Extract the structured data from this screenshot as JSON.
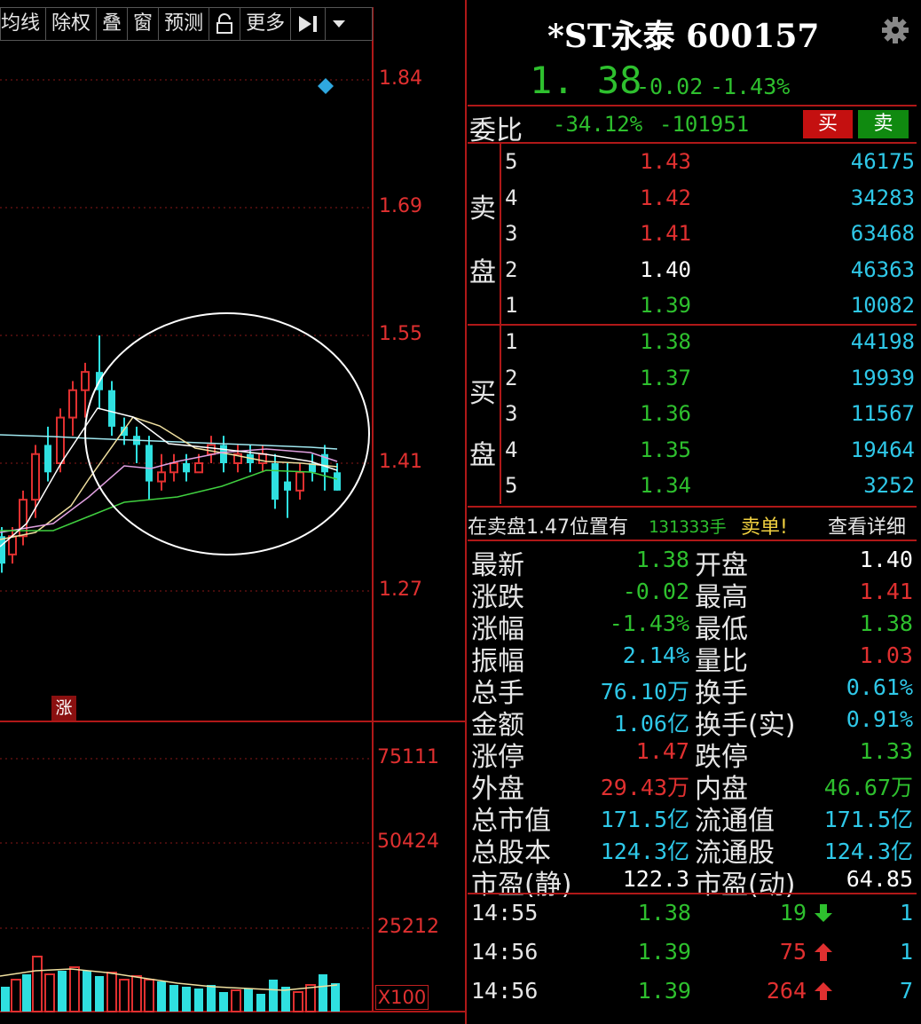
{
  "toolbar": {
    "items": [
      "均线",
      "除权",
      "叠",
      "窗",
      "预测",
      "更多"
    ]
  },
  "price_axis": [
    "1.84",
    "1.69",
    "1.55",
    "1.41",
    "1.27"
  ],
  "volume_axis": [
    "75111",
    "50424",
    "25212"
  ],
  "volume_unit": "X100",
  "rise_badge": "涨",
  "colors": {
    "up": "#e03030",
    "down": "#2fe0e0",
    "green": "#2ec02e",
    "cyan": "#2fc8e8",
    "grid_red": "#b01818"
  },
  "quote": {
    "title": "*ST永泰 600157",
    "last": "1. 38",
    "change": "-0.02",
    "change_pct": "-1.43%",
    "weibi_label": "委比",
    "weibi": "-34.12%",
    "weicha": "-101951",
    "buy_label": "买",
    "sell_label": "卖"
  },
  "order_book": {
    "sell_label_1": "卖",
    "sell_label_2": "盘",
    "buy_label_1": "买",
    "buy_label_2": "盘",
    "asks": [
      {
        "level": "5",
        "price": "1.43",
        "volume": "46175",
        "color": "#e03030"
      },
      {
        "level": "4",
        "price": "1.42",
        "volume": "34283",
        "color": "#e03030"
      },
      {
        "level": "3",
        "price": "1.41",
        "volume": "63468",
        "color": "#e03030"
      },
      {
        "level": "2",
        "price": "1.40",
        "volume": "46363",
        "color": "#ffffff"
      },
      {
        "level": "1",
        "price": "1.39",
        "volume": "10082",
        "color": "#2ec02e"
      }
    ],
    "bids": [
      {
        "level": "1",
        "price": "1.38",
        "volume": "44198",
        "color": "#2ec02e"
      },
      {
        "level": "2",
        "price": "1.37",
        "volume": "19939",
        "color": "#2ec02e"
      },
      {
        "level": "3",
        "price": "1.36",
        "volume": "11567",
        "color": "#2ec02e"
      },
      {
        "level": "4",
        "price": "1.35",
        "volume": "19464",
        "color": "#2ec02e"
      },
      {
        "level": "5",
        "price": "1.34",
        "volume": "3252",
        "color": "#2ec02e"
      }
    ]
  },
  "notice": {
    "prefix": "在卖盘1.47位置有",
    "amount": "131333手",
    "suffix": "卖单!",
    "link": "查看详细"
  },
  "stats": [
    {
      "l1": "最新",
      "v1": "1.38",
      "c1": "#2ec02e",
      "l2": "开盘",
      "v2": "1.40",
      "c2": "#ffffff"
    },
    {
      "l1": "涨跌",
      "v1": "-0.02",
      "c1": "#2ec02e",
      "l2": "最高",
      "v2": "1.41",
      "c2": "#e03030"
    },
    {
      "l1": "涨幅",
      "v1": "-1.43%",
      "c1": "#2ec02e",
      "l2": "最低",
      "v2": "1.38",
      "c2": "#2ec02e"
    },
    {
      "l1": "振幅",
      "v1": "2.14%",
      "c1": "#2fc8e8",
      "l2": "量比",
      "v2": "1.03",
      "c2": "#e03030"
    },
    {
      "l1": "总手",
      "v1": "76.10万",
      "c1": "#2fc8e8",
      "l2": "换手",
      "v2": "0.61%",
      "c2": "#2fc8e8"
    },
    {
      "l1": "金额",
      "v1": "1.06亿",
      "c1": "#2fc8e8",
      "l2": "换手(实)",
      "v2": "0.91%",
      "c2": "#2fc8e8"
    },
    {
      "l1": "涨停",
      "v1": "1.47",
      "c1": "#e03030",
      "l2": "跌停",
      "v2": "1.33",
      "c2": "#2ec02e"
    },
    {
      "l1": "外盘",
      "v1": "29.43万",
      "c1": "#e03030",
      "l2": "内盘",
      "v2": "46.67万",
      "c2": "#2ec02e"
    },
    {
      "l1": "总市值",
      "v1": "171.5亿",
      "c1": "#2fc8e8",
      "l2": "流通值",
      "v2": "171.5亿",
      "c2": "#2fc8e8"
    },
    {
      "l1": "总股本",
      "v1": "124.3亿",
      "c1": "#2fc8e8",
      "l2": "流通股",
      "v2": "124.3亿",
      "c2": "#2fc8e8"
    },
    {
      "l1": "市盈(静)",
      "v1": "122.3",
      "c1": "#ffffff",
      "l2": "市盈(动)",
      "v2": "64.85",
      "c2": "#ffffff"
    }
  ],
  "ticks": [
    {
      "time": "14:55",
      "price": "1.38",
      "pcolor": "#2ec02e",
      "vol": "19",
      "vcolor": "#2ec02e",
      "dir": "down",
      "n": "1"
    },
    {
      "time": "14:56",
      "price": "1.39",
      "pcolor": "#2ec02e",
      "vol": "75",
      "vcolor": "#e03030",
      "dir": "up",
      "n": "1"
    },
    {
      "time": "14:56",
      "price": "1.39",
      "pcolor": "#2ec02e",
      "vol": "264",
      "vcolor": "#e03030",
      "dir": "up",
      "n": "7"
    }
  ]
}
